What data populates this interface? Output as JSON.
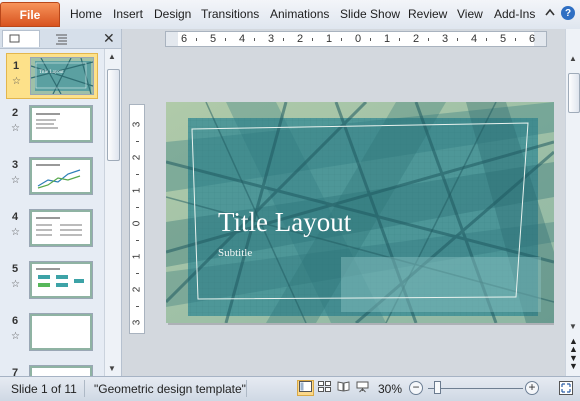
{
  "ribbon": {
    "file_label": "File",
    "tabs": [
      "Home",
      "Insert",
      "Design",
      "Transitions",
      "Animations",
      "Slide Show",
      "Review",
      "View",
      "Add-Ins"
    ]
  },
  "thumbnail_panel": {
    "slides": [
      {
        "number": "1",
        "selected": true,
        "thumb_title": "Title Layout"
      },
      {
        "number": "2",
        "selected": false
      },
      {
        "number": "3",
        "selected": false
      },
      {
        "number": "4",
        "selected": false
      },
      {
        "number": "5",
        "selected": false
      },
      {
        "number": "6",
        "selected": false
      },
      {
        "number": "7",
        "selected": false
      }
    ]
  },
  "rulers": {
    "horizontal": [
      "6",
      "5",
      "4",
      "3",
      "2",
      "1",
      "0",
      "1",
      "2",
      "3",
      "4",
      "5",
      "6"
    ],
    "vertical": [
      "3",
      "2",
      "1",
      "0",
      "1",
      "2",
      "3"
    ]
  },
  "slide": {
    "title": "Title Layout",
    "subtitle": "Subtitle"
  },
  "status": {
    "slide_info": "Slide 1 of 11",
    "theme": "\"Geometric design template\"",
    "zoom": "30%",
    "zoom_level": 0.3
  },
  "colors": {
    "file_tab": "#e0602a",
    "slide_teal": "#3f8f95",
    "slide_green": "#9fc0a8",
    "selection": "#fde18a"
  },
  "icons": [
    "chevron-up-icon",
    "help-icon",
    "slides-tab-icon",
    "outline-tab-icon",
    "close-icon",
    "star-icon",
    "normal-view-icon",
    "slide-sorter-icon",
    "reading-view-icon",
    "slideshow-icon",
    "fit-window-icon"
  ]
}
